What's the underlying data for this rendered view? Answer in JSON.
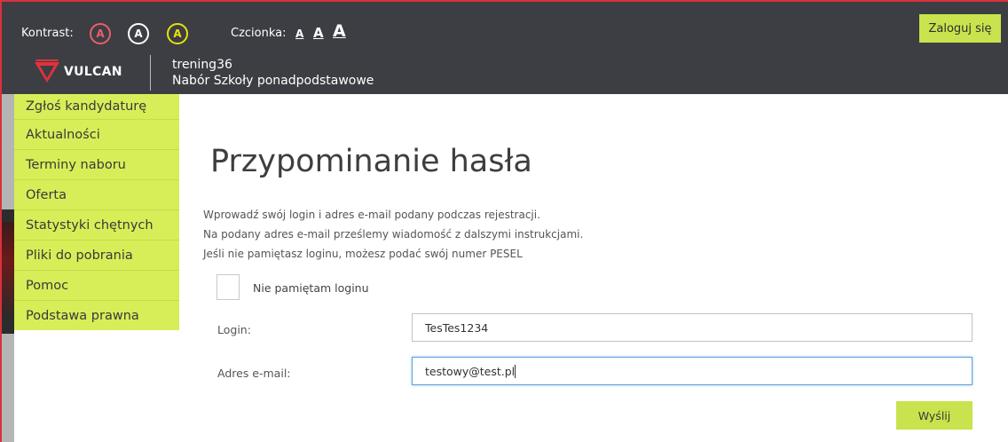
{
  "header": {
    "contrast_label": "Kontrast:",
    "contrast_options": [
      "A",
      "A",
      "A"
    ],
    "font_label": "Czcionka:",
    "font_sizes": [
      "A",
      "A",
      "A"
    ],
    "login_button": "Zaloguj się",
    "logo_text": "VULCAN",
    "institution_name": "trening36",
    "institution_subtitle": "Nabór Szkoły ponadpodstawowe"
  },
  "sidebar": {
    "items": [
      {
        "label": "Zgłoś kandydaturę"
      },
      {
        "label": "Aktualności"
      },
      {
        "label": "Terminy naboru"
      },
      {
        "label": "Oferta"
      },
      {
        "label": "Statystyki chętnych"
      },
      {
        "label": "Pliki do pobrania"
      },
      {
        "label": "Pomoc"
      },
      {
        "label": "Podstawa prawna"
      }
    ]
  },
  "main": {
    "title": "Przypominanie hasła",
    "instructions": [
      "Wprowadź swój login i adres e-mail podany podczas rejestracji.",
      "Na podany adres e-mail prześlemy wiadomość z dalszymi instrukcjami.",
      "Jeśli nie pamiętasz loginu, możesz podać swój numer PESEL"
    ],
    "checkbox_label": "Nie pamiętam loginu",
    "login_label": "Login:",
    "login_value": "TesTes1234",
    "email_label": "Adres e-mail:",
    "email_value": "testowy@test.pl",
    "submit_label": "Wyślij"
  },
  "colors": {
    "header_bg": "#3d3e43",
    "accent_green": "#c8e34d",
    "menu_green": "#d7ee58",
    "frame_red": "#d9323c"
  },
  "icons": {
    "logo": "vulcan-logo-icon"
  }
}
